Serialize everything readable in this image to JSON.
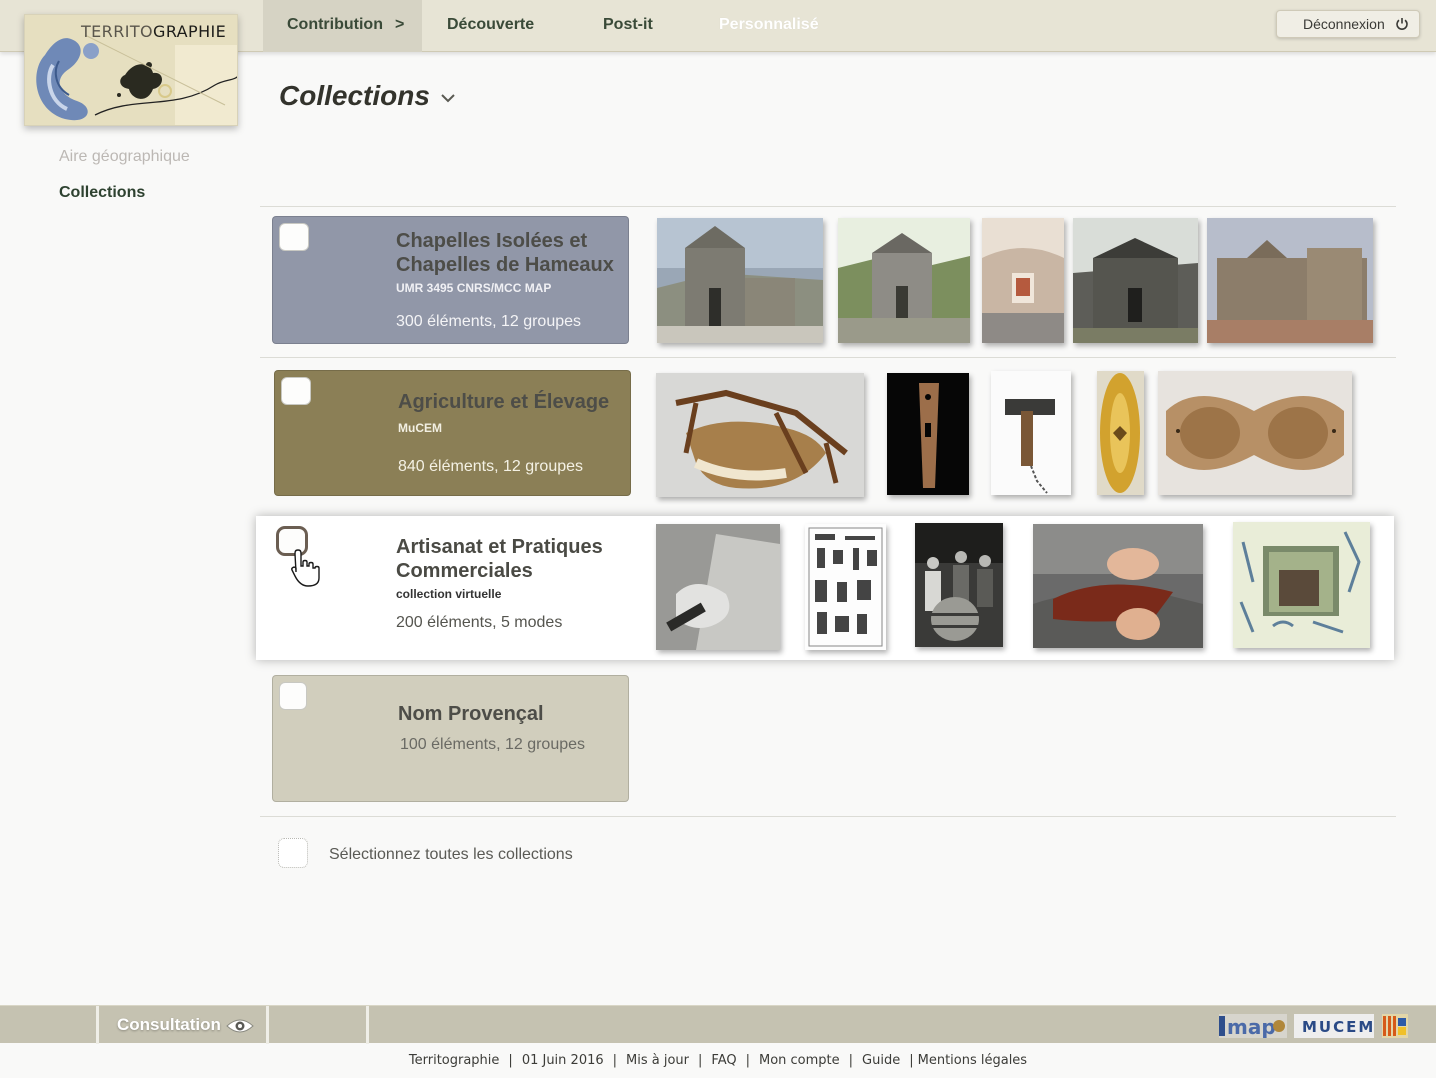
{
  "logo": {
    "text_a": "TERRITO",
    "text_b": "GRAPHIE"
  },
  "nav": {
    "contribution": "Contribution",
    "contribution_arrow": ">",
    "decouverte": "Découverte",
    "postit": "Post-it",
    "personnalise": "Personnalisé",
    "logout": "Déconnexion"
  },
  "sidebar": {
    "items": [
      {
        "label": "Aire géographique"
      },
      {
        "label": "Collections"
      }
    ]
  },
  "page": {
    "title": "Collections"
  },
  "collections": [
    {
      "title_1": "Chapelles Isolées et",
      "title_2": "Chapelles de Hameaux",
      "subtitle": "UMR 3495 CNRS/MCC MAP",
      "count": "300 éléments, 12 groupes",
      "color": "#9197a8"
    },
    {
      "title_1": "Agriculture et Élevage",
      "subtitle": "MuCEM",
      "count": "840 éléments, 12 groupes",
      "color": "#8b7f56"
    },
    {
      "title_1": "Artisanat et Pratiques",
      "title_2": "Commerciales",
      "subtitle": "collection virtuelle",
      "count": "200 éléments, 5 modes",
      "color": "#ffffff"
    },
    {
      "title_1": "Nom Provençal",
      "count": "100 éléments, 12 groupes",
      "color": "#d1cebd"
    }
  ],
  "select_all": "Sélectionnez toutes les collections",
  "bottombar": {
    "consultation": "Consultation",
    "partner_1": "map",
    "partner_2": "MUCEM"
  },
  "footer": {
    "items": [
      "Territographie",
      "01 Juin 2016",
      "Mis à jour",
      "FAQ",
      "Mon compte",
      "Guide",
      "Mentions légales"
    ]
  }
}
